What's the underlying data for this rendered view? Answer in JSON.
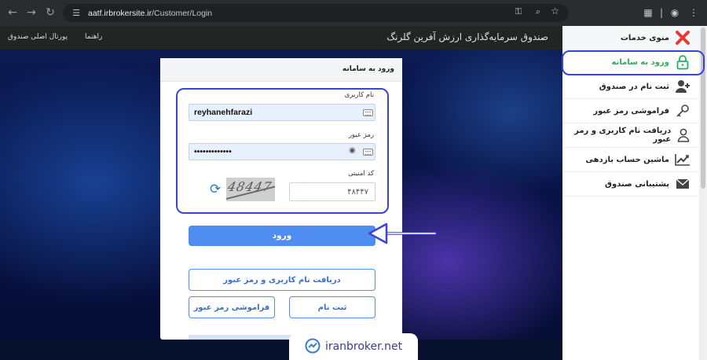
{
  "browser": {
    "url_host": "aatf.irbrokersite.ir",
    "url_path": "/Customer/Login"
  },
  "topbar": {
    "brand": "صندوق سرمایه‌گذاری ارزش آفرین گلرنگ",
    "links": [
      "راهنما",
      "پورتال اصلی صندوق"
    ]
  },
  "sidebar": {
    "items": [
      {
        "label": "منوی خدمات",
        "icon": "close-icon"
      },
      {
        "label": "ورود به سامانه",
        "icon": "lock-icon",
        "active": true
      },
      {
        "label": "ثبت نام در صندوق",
        "icon": "add-user-icon"
      },
      {
        "label": "فراموشی رمز عبور",
        "icon": "key-icon"
      },
      {
        "label": "دریافت نام کاربری و رمز عبور",
        "icon": "user-icon"
      },
      {
        "label": "ماشین حساب بازدهی",
        "icon": "chart-icon"
      },
      {
        "label": "پشتیبانی صندوق",
        "icon": "envelope-icon"
      }
    ]
  },
  "login": {
    "title": "ورود به سامانه",
    "username_label": "نام کاربری",
    "username_value": "reyhanehfarazi",
    "password_label": "رمز عبور",
    "password_value": "•••••••••••••",
    "captcha_label": "کد امنیتی",
    "captcha_image_text": "48447",
    "captcha_value": "۴۸۴۴۷",
    "submit_label": "ورود",
    "get_credentials_label": "دریافت نام کاربری و رمز عبور",
    "register_label": "ثبت نام",
    "forgot_label": "فراموشی رمز عبور"
  },
  "watermark": {
    "text": "iranbroker.net"
  },
  "colors": {
    "accent": "#4f8df0",
    "annotation": "#3a45d8",
    "active_menu": "#27ae60",
    "close_icon": "#e53935"
  }
}
